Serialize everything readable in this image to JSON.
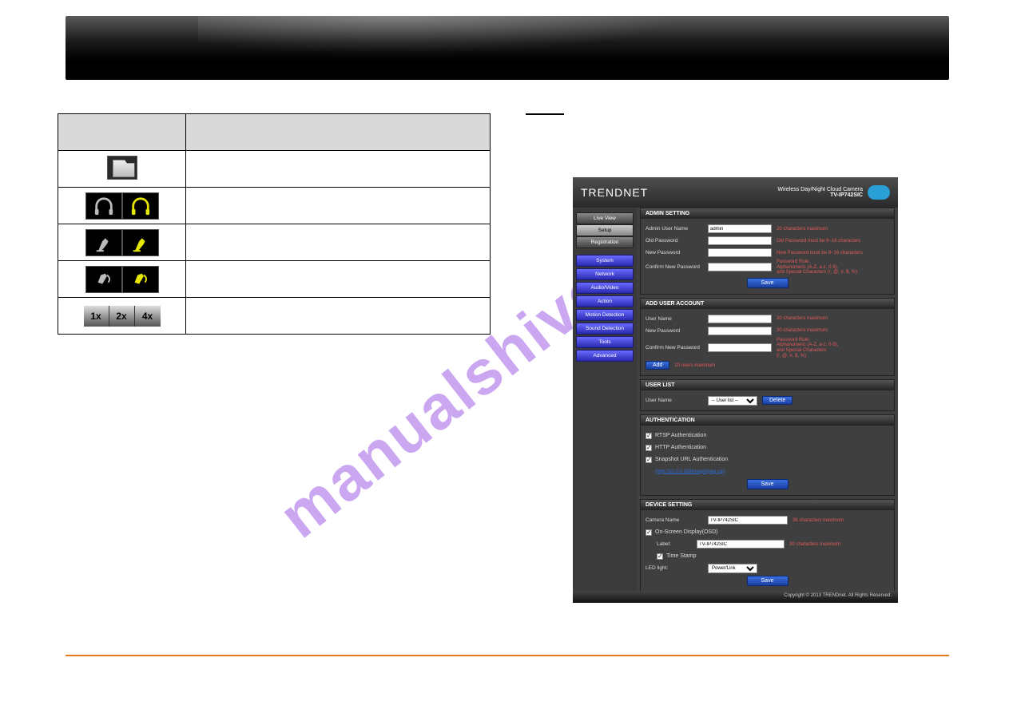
{
  "watermark": "manualshive.com",
  "table_header": {
    "icon": "",
    "desc": ""
  },
  "zoom": {
    "a": "1x",
    "b": "2x",
    "c": "4x"
  },
  "shot": {
    "brand": "TRENDNET",
    "title_line1": "Wireless Day/Night Cloud Camera",
    "title_line2": "TV-IP742SIC",
    "cloud": "TRENDnet Cloud",
    "nav_top": [
      "Live View",
      "Setup",
      "Registration"
    ],
    "nav": [
      "System",
      "Network",
      "Audio/Video",
      "Action",
      "Motion Detection",
      "Sound Detection",
      "Tools",
      "Advanced"
    ],
    "panels": {
      "admin": {
        "title": "ADMIN SETTING",
        "user_lbl": "Admin User Name",
        "user_val": "admin",
        "user_note": "20 characters maximum",
        "old_lbl": "Old Password",
        "old_note": "Old Password must be 8~16 characters",
        "new_lbl": "New Password",
        "new_note": "New Password must be 8~16 characters",
        "conf_lbl": "Confirm New Password",
        "rule": "Password Rule:\nAlphanumeric (A-Z, a-z, 0-9),\nand Special Characters (!, @, #, $, %)",
        "save": "Save"
      },
      "add": {
        "title": "ADD USER ACCOUNT",
        "user_lbl": "User Name",
        "user_note": "30 characters maximum",
        "new_lbl": "New Password",
        "new_note": "30 characters maximum",
        "conf_lbl": "Confirm New Password",
        "rule": "Password Rule:\nAlphanumeric (A-Z, a-z, 0-9),\nand Special Characters\n(!, @, #, $, %)",
        "add": "Add",
        "limit": "20 users maximum"
      },
      "list": {
        "title": "USER LIST",
        "user_lbl": "User Name",
        "sel": "-- User list --",
        "del": "Delete"
      },
      "auth": {
        "title": "AUTHENTICATION",
        "rtsp": "RTSP Authentication",
        "http": "HTTP Authentication",
        "snap": "Snapshot URL Authentication",
        "url": "(http://10.0.0.158/image/jpeg.cgi)",
        "save": "Save"
      },
      "dev": {
        "title": "DEVICE SETTING",
        "name_lbl": "Camera Name",
        "name_val": "TV-IP742SIC",
        "name_note": "36 characters maximum",
        "osd_lbl": "On-Screen Display(OSD)",
        "label_lbl": "Label:",
        "label_val": "TV-IP742SIC",
        "label_note": "30 characters maximum",
        "ts_lbl": "Time Stamp",
        "led_lbl": "LED light:",
        "led_val": "Power/Link",
        "save": "Save"
      }
    },
    "copyright": "Copyright © 2013 TRENDnet. All Rights Reserved."
  }
}
